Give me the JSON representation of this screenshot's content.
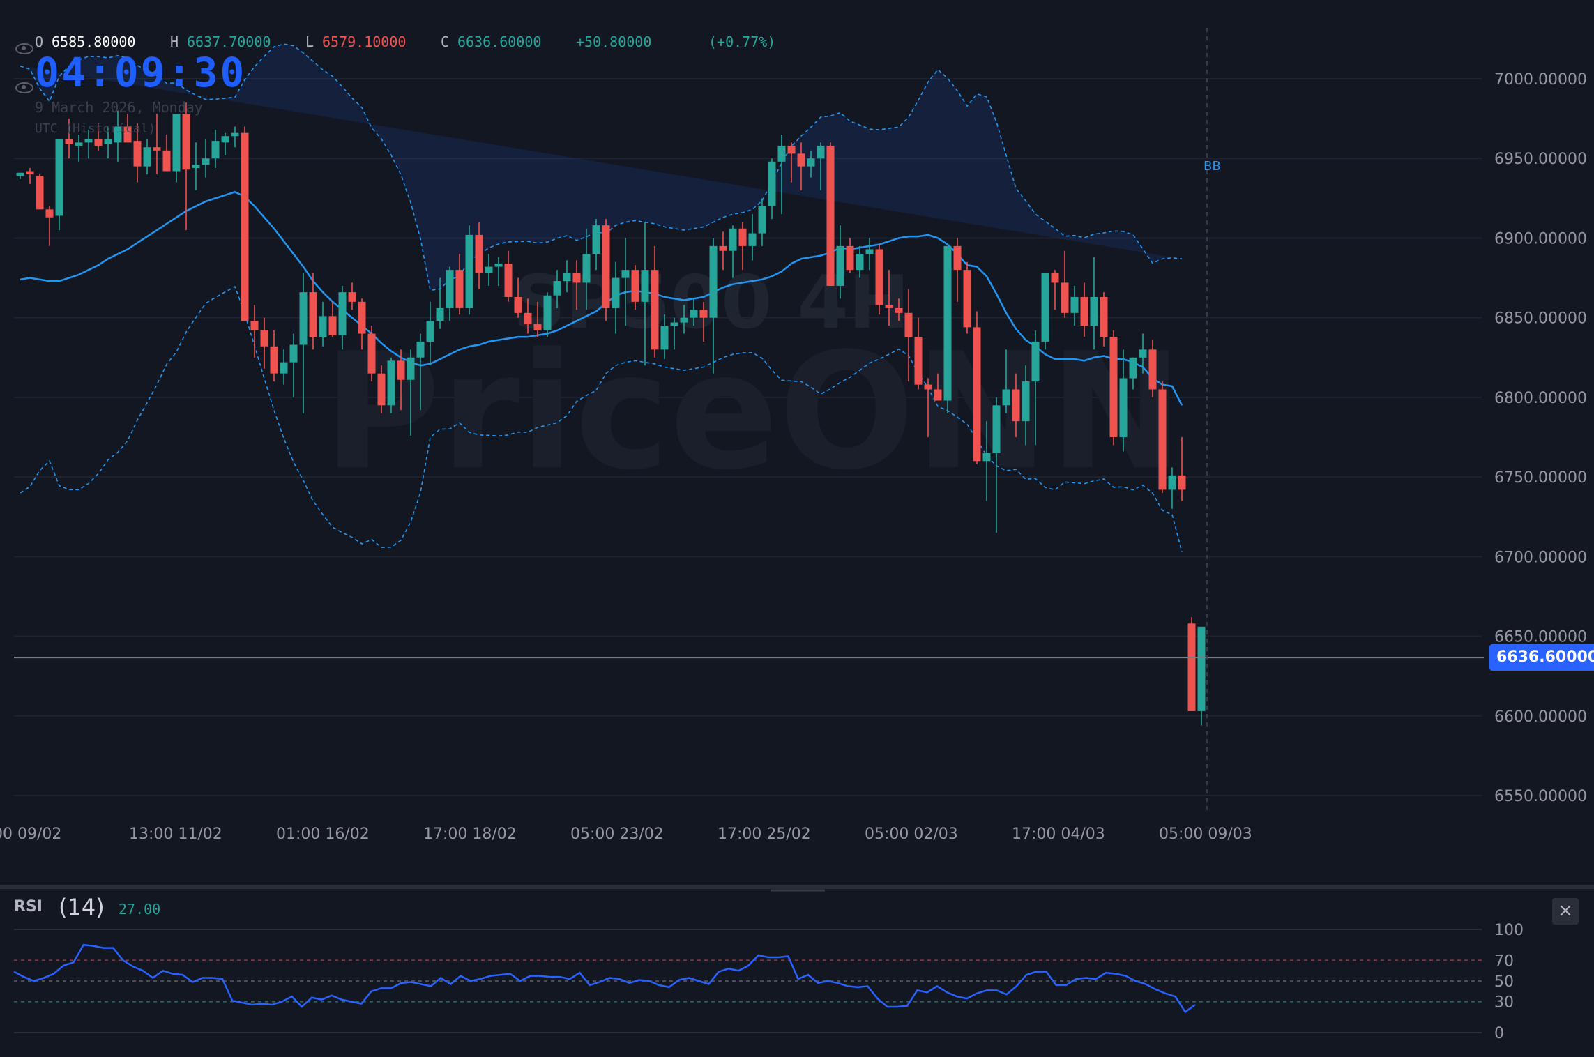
{
  "ohlc": {
    "o_label": "O",
    "o_value": "6585.80000",
    "h_label": "H",
    "h_value": "6637.70000",
    "l_label": "L",
    "l_value": "6579.10000",
    "c_label": "C",
    "c_value": "6636.60000",
    "change": "+50.80000",
    "change_pct": "(+0.77%)"
  },
  "clock": "04:09:30",
  "date_text": "9 March 2026, Monday",
  "tz_text": "UTC (Historical)",
  "watermark": {
    "line1": "SP500 4H",
    "line2": "PriceONN"
  },
  "indicator_label": "BB",
  "last_price_tag": "6636.60000",
  "rsi": {
    "title": "RSI",
    "period": "(14)",
    "value": "27.00",
    "close_icon": "×"
  },
  "colors": {
    "up": "#26a69a",
    "down": "#ef5350",
    "bb_mid": "#2196f3",
    "bb_band": "#2962ff",
    "rsi_line": "#2962ff",
    "accent": "#2962ff"
  },
  "chart_data": [
    {
      "type": "candlestick",
      "title": "SP500 4H",
      "y_ticks": [
        "7000.00000",
        "6950.00000",
        "6900.00000",
        "6850.00000",
        "6800.00000",
        "6750.00000",
        "6700.00000",
        "6650.00000",
        "6600.00000",
        "6550.00000"
      ],
      "ylim": [
        6535,
        7045
      ],
      "x_ticks": [
        "00 09/02",
        "13:00 11/02",
        "01:00 16/02",
        "17:00 18/02",
        "05:00 23/02",
        "17:00 25/02",
        "05:00 02/03",
        "17:00 04/03",
        "05:00 09/03"
      ],
      "last_price": 6636.6,
      "candles_ohlc": [
        [
          6939,
          6941,
          6937,
          6941
        ],
        [
          6942,
          6944,
          6934,
          6940
        ],
        [
          6939,
          6940,
          6920,
          6918
        ],
        [
          6918,
          6920,
          6895,
          6913
        ],
        [
          6914,
          6960,
          6905,
          6962
        ],
        [
          6962,
          6975,
          6950,
          6959
        ],
        [
          6958,
          6965,
          6948,
          6960
        ],
        [
          6960,
          6968,
          6950,
          6962
        ],
        [
          6962,
          6972,
          6955,
          6958
        ],
        [
          6959,
          6970,
          6950,
          6962
        ],
        [
          6960,
          6980,
          6948,
          6970
        ],
        [
          6970,
          6978,
          6960,
          6960
        ],
        [
          6961,
          6972,
          6935,
          6945
        ],
        [
          6945,
          6962,
          6940,
          6957
        ],
        [
          6957,
          6978,
          6940,
          6955
        ],
        [
          6955,
          6965,
          6943,
          6942
        ],
        [
          6942,
          6975,
          6935,
          6978
        ],
        [
          6978,
          6985,
          6905,
          6943
        ],
        [
          6944,
          6960,
          6930,
          6946
        ],
        [
          6946,
          6962,
          6938,
          6950
        ],
        [
          6950,
          6968,
          6944,
          6961
        ],
        [
          6960,
          6966,
          6952,
          6964
        ],
        [
          6964,
          6970,
          6957,
          6966
        ],
        [
          6966,
          6970,
          6848,
          6848
        ],
        [
          6848,
          6858,
          6825,
          6842
        ],
        [
          6842,
          6850,
          6818,
          6832
        ],
        [
          6832,
          6842,
          6810,
          6815
        ],
        [
          6815,
          6830,
          6808,
          6822
        ],
        [
          6822,
          6840,
          6800,
          6833
        ],
        [
          6833,
          6878,
          6790,
          6866
        ],
        [
          6866,
          6878,
          6830,
          6838
        ],
        [
          6838,
          6860,
          6832,
          6851
        ],
        [
          6851,
          6860,
          6838,
          6839
        ],
        [
          6839,
          6870,
          6830,
          6866
        ],
        [
          6866,
          6872,
          6855,
          6860
        ],
        [
          6860,
          6862,
          6830,
          6840
        ],
        [
          6840,
          6845,
          6810,
          6815
        ],
        [
          6815,
          6820,
          6790,
          6795
        ],
        [
          6795,
          6825,
          6790,
          6823
        ],
        [
          6823,
          6830,
          6792,
          6811
        ],
        [
          6811,
          6830,
          6776,
          6825
        ],
        [
          6825,
          6840,
          6792,
          6835
        ],
        [
          6835,
          6860,
          6820,
          6848
        ],
        [
          6848,
          6875,
          6843,
          6856
        ],
        [
          6856,
          6882,
          6848,
          6880
        ],
        [
          6880,
          6890,
          6852,
          6856
        ],
        [
          6856,
          6908,
          6852,
          6902
        ],
        [
          6902,
          6910,
          6868,
          6878
        ],
        [
          6878,
          6890,
          6870,
          6882
        ],
        [
          6882,
          6888,
          6870,
          6884
        ],
        [
          6884,
          6892,
          6860,
          6863
        ],
        [
          6863,
          6875,
          6850,
          6853
        ],
        [
          6853,
          6862,
          6840,
          6846
        ],
        [
          6846,
          6860,
          6838,
          6842
        ],
        [
          6842,
          6866,
          6838,
          6864
        ],
        [
          6864,
          6880,
          6856,
          6873
        ],
        [
          6873,
          6886,
          6866,
          6878
        ],
        [
          6878,
          6886,
          6855,
          6872
        ],
        [
          6872,
          6906,
          6855,
          6890
        ],
        [
          6890,
          6912,
          6880,
          6908
        ],
        [
          6908,
          6912,
          6848,
          6856
        ],
        [
          6856,
          6885,
          6840,
          6875
        ],
        [
          6875,
          6900,
          6845,
          6880
        ],
        [
          6880,
          6883,
          6855,
          6860
        ],
        [
          6860,
          6910,
          6820,
          6880
        ],
        [
          6880,
          6895,
          6825,
          6830
        ],
        [
          6830,
          6852,
          6824,
          6845
        ],
        [
          6845,
          6850,
          6830,
          6847
        ],
        [
          6847,
          6858,
          6840,
          6850
        ],
        [
          6850,
          6862,
          6845,
          6855
        ],
        [
          6855,
          6860,
          6835,
          6850
        ],
        [
          6850,
          6900,
          6815,
          6895
        ],
        [
          6895,
          6904,
          6880,
          6892
        ],
        [
          6892,
          6908,
          6875,
          6906
        ],
        [
          6906,
          6910,
          6880,
          6895
        ],
        [
          6895,
          6915,
          6886,
          6903
        ],
        [
          6903,
          6925,
          6895,
          6920
        ],
        [
          6920,
          6950,
          6912,
          6948
        ],
        [
          6948,
          6965,
          6915,
          6958
        ],
        [
          6958,
          6960,
          6935,
          6953
        ],
        [
          6953,
          6960,
          6930,
          6945
        ],
        [
          6945,
          6955,
          6938,
          6950
        ],
        [
          6950,
          6960,
          6930,
          6958
        ],
        [
          6958,
          6960,
          6870,
          6870
        ],
        [
          6870,
          6908,
          6862,
          6895
        ],
        [
          6895,
          6900,
          6878,
          6880
        ],
        [
          6880,
          6895,
          6875,
          6890
        ],
        [
          6890,
          6900,
          6880,
          6893
        ],
        [
          6893,
          6896,
          6852,
          6858
        ],
        [
          6858,
          6880,
          6845,
          6856
        ],
        [
          6856,
          6862,
          6848,
          6853
        ],
        [
          6853,
          6868,
          6810,
          6838
        ],
        [
          6838,
          6850,
          6805,
          6808
        ],
        [
          6808,
          6812,
          6775,
          6805
        ],
        [
          6805,
          6815,
          6800,
          6798
        ],
        [
          6798,
          6895,
          6790,
          6895
        ],
        [
          6895,
          6900,
          6860,
          6880
        ],
        [
          6880,
          6885,
          6840,
          6844
        ],
        [
          6844,
          6854,
          6758,
          6760
        ],
        [
          6760,
          6785,
          6735,
          6765
        ],
        [
          6765,
          6800,
          6715,
          6795
        ],
        [
          6795,
          6830,
          6790,
          6805
        ],
        [
          6805,
          6815,
          6775,
          6785
        ],
        [
          6785,
          6820,
          6770,
          6810
        ],
        [
          6810,
          6842,
          6770,
          6835
        ],
        [
          6835,
          6875,
          6830,
          6878
        ],
        [
          6878,
          6880,
          6855,
          6872
        ],
        [
          6872,
          6892,
          6850,
          6853
        ],
        [
          6853,
          6870,
          6845,
          6863
        ],
        [
          6863,
          6872,
          6838,
          6845
        ],
        [
          6845,
          6888,
          6830,
          6863
        ],
        [
          6863,
          6866,
          6832,
          6838
        ],
        [
          6838,
          6842,
          6770,
          6775
        ],
        [
          6775,
          6830,
          6766,
          6812
        ],
        [
          6812,
          6825,
          6805,
          6825
        ],
        [
          6825,
          6840,
          6815,
          6830
        ],
        [
          6830,
          6836,
          6800,
          6805
        ],
        [
          6805,
          6810,
          6740,
          6742
        ],
        [
          6742,
          6756,
          6730,
          6751
        ],
        [
          6751,
          6775,
          6735,
          6742
        ],
        [
          6658,
          6662,
          6603,
          6603
        ],
        [
          6603,
          6637,
          6594,
          6656
        ]
      ],
      "bollinger_mid": [
        6874,
        6875,
        6874,
        6873,
        6873,
        6875,
        6877,
        6880,
        6883,
        6887,
        6890,
        6893,
        6897,
        6901,
        6905,
        6909,
        6913,
        6917,
        6920,
        6923,
        6925,
        6927,
        6929,
        6926,
        6920,
        6913,
        6906,
        6898,
        6890,
        6882,
        6873,
        6866,
        6860,
        6855,
        6850,
        6845,
        6840,
        6834,
        6829,
        6825,
        6822,
        6820,
        6821,
        6824,
        6827,
        6830,
        6832,
        6833,
        6835,
        6836,
        6837,
        6838,
        6838,
        6839,
        6840,
        6842,
        6845,
        6848,
        6851,
        6854,
        6859,
        6864,
        6866,
        6867,
        6866,
        6865,
        6863,
        6862,
        6861,
        6862,
        6863,
        6866,
        6869,
        6871,
        6872,
        6873,
        6874,
        6876,
        6879,
        6884,
        6887,
        6888,
        6889,
        6891,
        6894,
        6893,
        6894,
        6895,
        6896,
        6898,
        6900,
        6901,
        6901,
        6902,
        6900,
        6896,
        6890,
        6883,
        6882,
        6876,
        6865,
        6853,
        6843,
        6836,
        6832,
        6827,
        6824,
        6824,
        6824,
        6823,
        6825,
        6826,
        6824,
        6824,
        6822,
        6819,
        6812,
        6808,
        6807,
        6795
      ]
    },
    {
      "type": "line",
      "title": "RSI (14)",
      "y_ticks": [
        "100",
        "70",
        "50",
        "30",
        "0"
      ],
      "ylim": [
        0,
        100
      ],
      "last_value": 27.0,
      "values": [
        59,
        54,
        50,
        53,
        57,
        65,
        68,
        85,
        84,
        82,
        82,
        70,
        64,
        60,
        53,
        60,
        57,
        56,
        49,
        53,
        53,
        52,
        31,
        29,
        27,
        28,
        27,
        30,
        35,
        25,
        34,
        32,
        36,
        32,
        30,
        28,
        40,
        43,
        43,
        48,
        49,
        47,
        45,
        53,
        47,
        55,
        50,
        52,
        55,
        56,
        57,
        50,
        55,
        55,
        54,
        54,
        52,
        58,
        46,
        49,
        53,
        52,
        48,
        51,
        50,
        46,
        44,
        51,
        53,
        50,
        47,
        59,
        62,
        60,
        65,
        75,
        73,
        73,
        74,
        52,
        56,
        48,
        50,
        48,
        45,
        44,
        45,
        33,
        25,
        25,
        26,
        41,
        39,
        45,
        39,
        35,
        33,
        38,
        41,
        41,
        37,
        45,
        56,
        59,
        59,
        46,
        46,
        52,
        53,
        52,
        58,
        57,
        55,
        50,
        47,
        42,
        38,
        35,
        20,
        27
      ]
    }
  ]
}
